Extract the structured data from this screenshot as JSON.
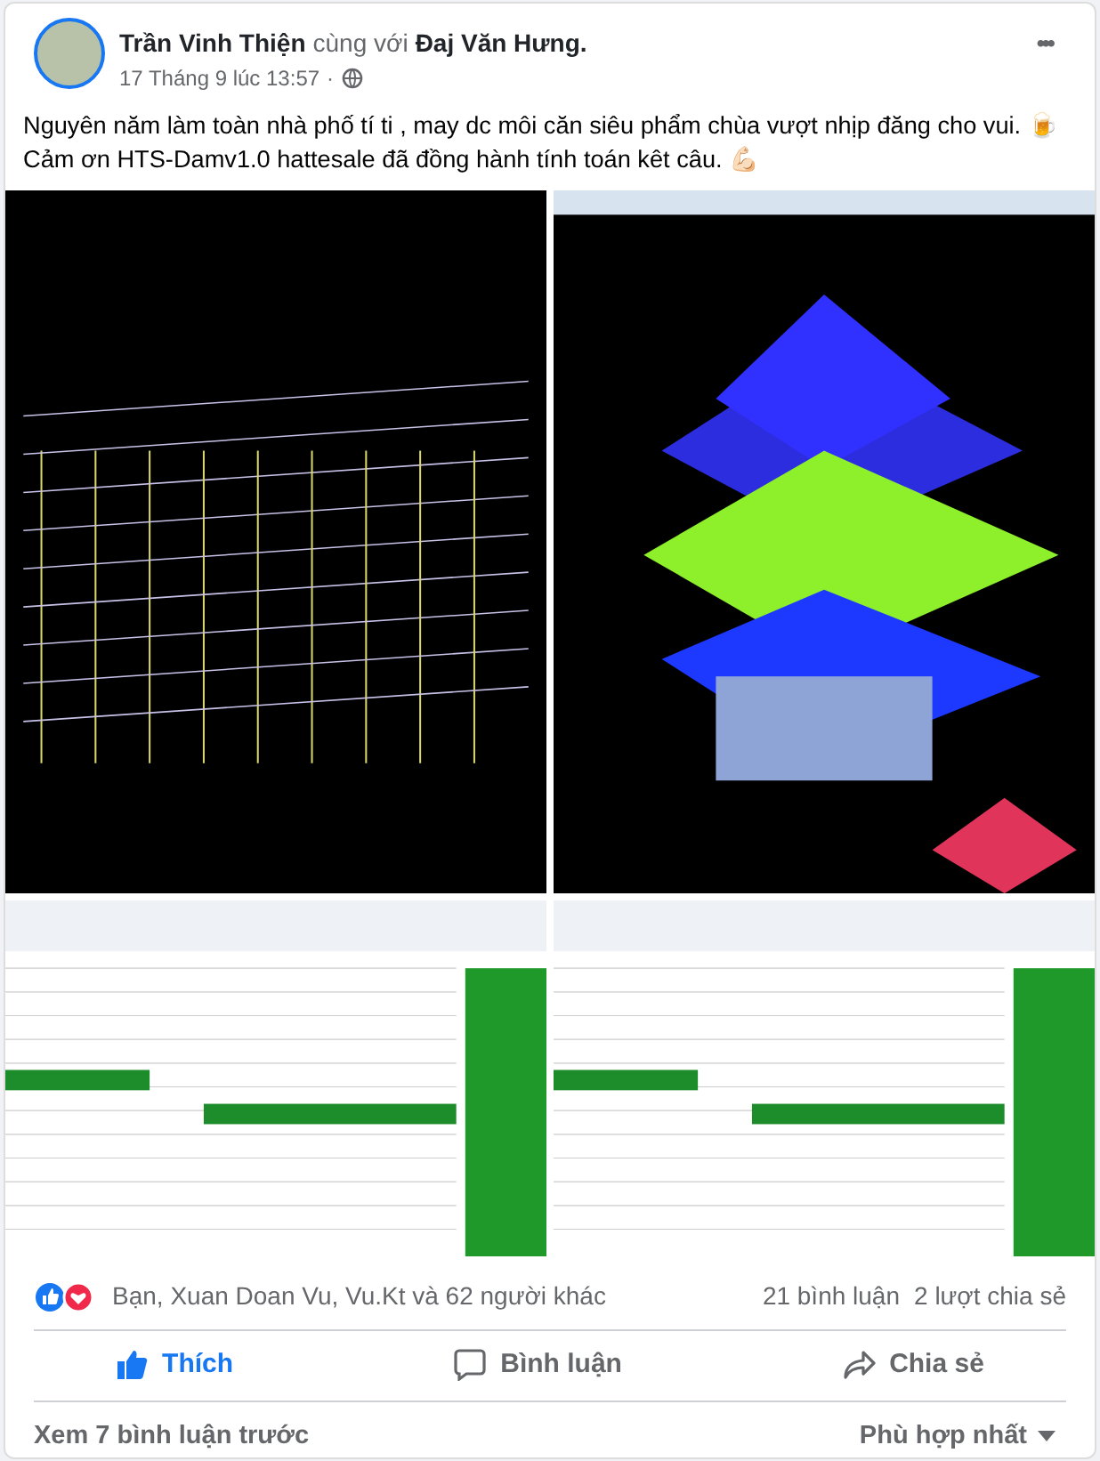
{
  "post": {
    "author": "Trần Vinh Thiện",
    "with_word": "cùng với",
    "tagged": "Đaj Văn Hưng",
    "tagged_end": ".",
    "time": "17 Tháng 9 lúc 13:57",
    "separator": "·",
    "menu": "•••",
    "lines": [
      "Nguyên năm làm toàn nhà phố tí ti , may dc môi căn siêu phẩm chùa vượt nhịp đăng cho vui. 🍺",
      "Cảm ơn HTS-Damv1.0 hattesale đã đồng hành tính toán kêt câu. 💪🏻"
    ]
  },
  "photos": [
    {
      "kind": "wireframe"
    },
    {
      "kind": "model3d"
    },
    {
      "kind": "sheet"
    },
    {
      "kind": "sheet"
    }
  ],
  "reactions": {
    "names": "Bạn, Xuan Doan Vu, Vu.Kt và 62 người khác",
    "comments": "21 bình luận",
    "shares": "2 lượt chia sẻ"
  },
  "actions": [
    {
      "kind": "like",
      "label": "Thích",
      "selected": true
    },
    {
      "kind": "comment",
      "label": "Bình luận",
      "selected": false
    },
    {
      "kind": "share",
      "label": "Chia sẻ",
      "selected": false
    }
  ],
  "footer": {
    "more": "Xem 7 bình luận trước",
    "sort": "Phù hợp nhất"
  }
}
